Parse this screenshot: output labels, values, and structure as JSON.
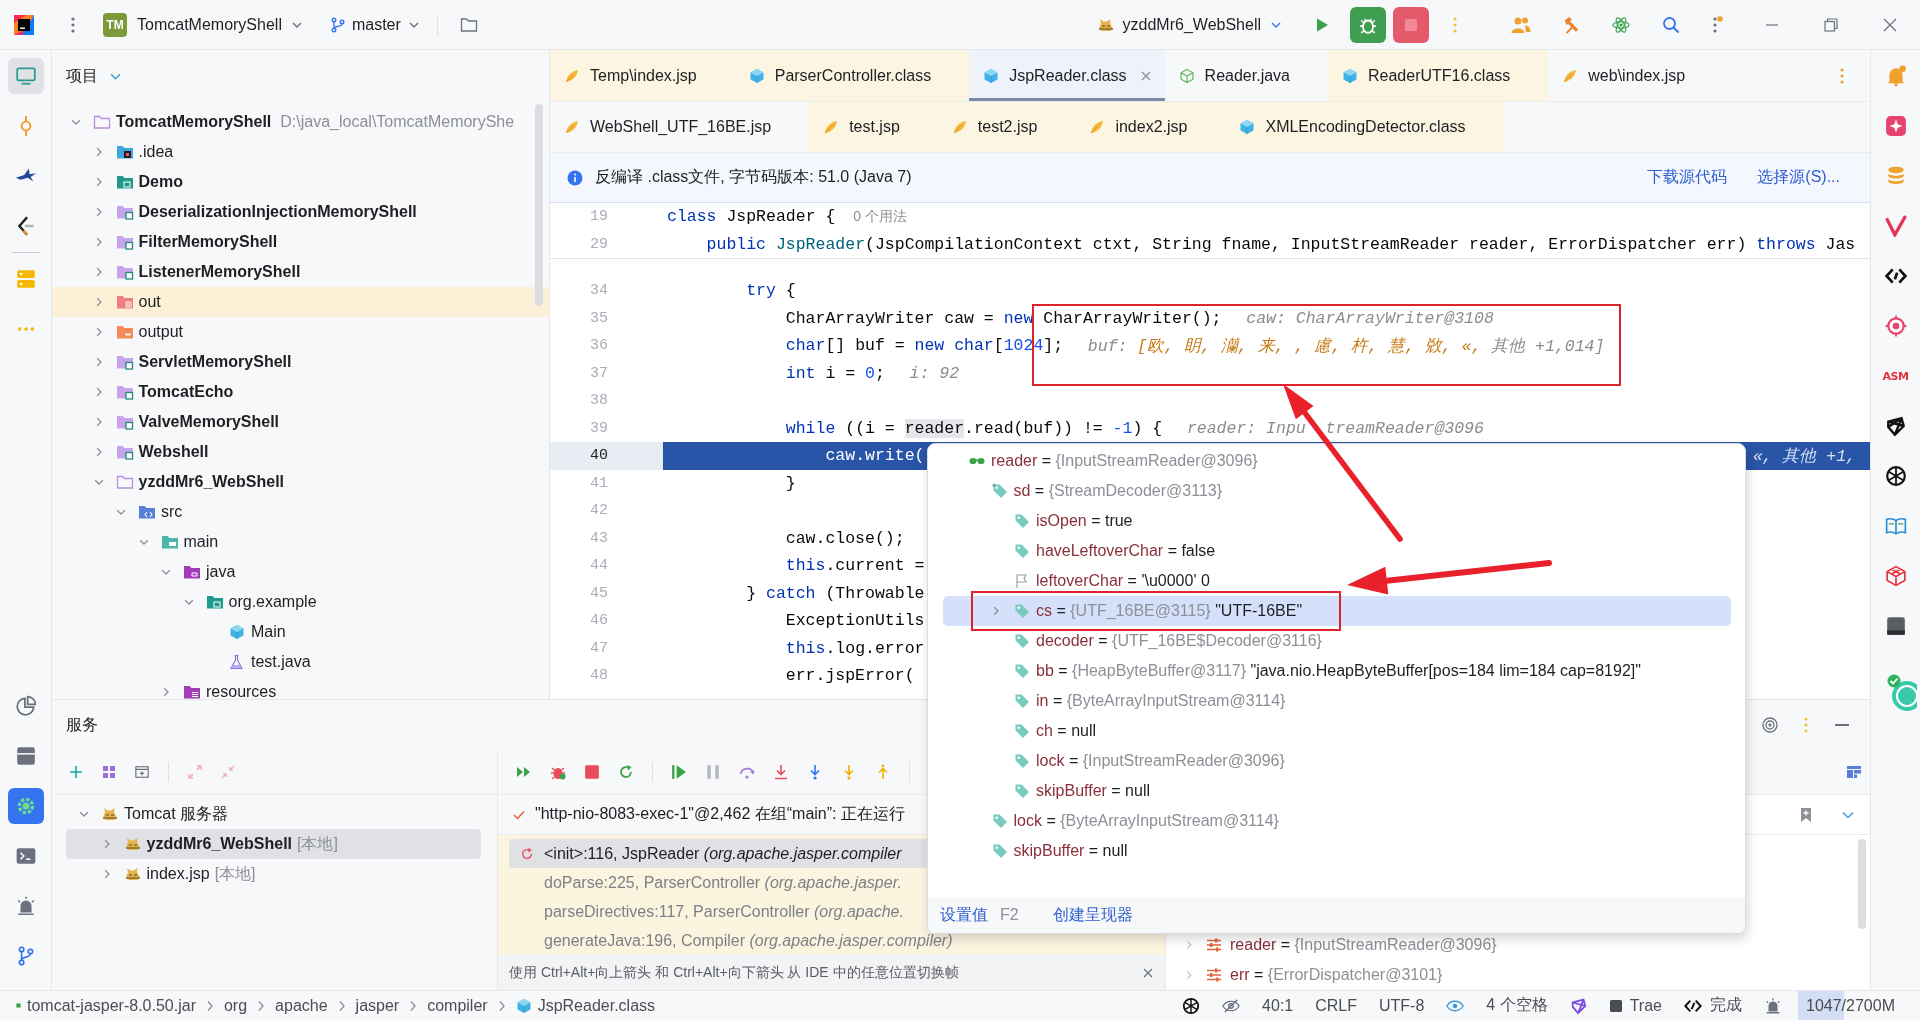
{
  "title_bar": {
    "project_badge": "TM",
    "project": "TomcatMemoryShell",
    "branch": "master",
    "run_config": "yzddMr6_WebShell"
  },
  "left_strip": {
    "top": [
      {
        "kind": "project",
        "selected": true
      },
      {
        "kind": "commit",
        "selected": false
      },
      {
        "kind": "plane",
        "selected": false
      },
      {
        "kind": "curly",
        "selected": false
      },
      {
        "kind": "server",
        "selected": false
      },
      {
        "kind": "more",
        "selected": false
      }
    ],
    "bottom": [
      {
        "kind": "profiler",
        "selected": false
      },
      {
        "kind": "archive",
        "selected": false
      },
      {
        "kind": "services",
        "selected": true
      },
      {
        "kind": "terminal",
        "selected": false
      },
      {
        "kind": "alarm",
        "selected": false
      },
      {
        "kind": "git",
        "selected": false
      }
    ]
  },
  "right_strip": [
    {
      "kind": "bell"
    },
    {
      "kind": "sparkle"
    },
    {
      "kind": "database"
    },
    {
      "kind": "vlogo"
    },
    {
      "kind": "code"
    },
    {
      "kind": "target"
    },
    {
      "kind": "asm",
      "label": "ASM"
    },
    {
      "kind": "gem"
    },
    {
      "kind": "wheel"
    },
    {
      "kind": "book"
    },
    {
      "kind": "cube"
    },
    {
      "kind": "square"
    },
    {
      "kind": "avatar"
    }
  ],
  "project_panel": {
    "title": "项目",
    "tree": [
      {
        "name": "TomcatMemoryShell",
        "path": "D:\\java_local\\TomcatMemoryShe",
        "kind": "project",
        "bold": true,
        "expanded": true,
        "highlighted": false,
        "children": [
          {
            "name": ".idea",
            "kind": "idea",
            "bold": false,
            "expanded": false,
            "highlighted": false
          },
          {
            "name": "Demo",
            "kind": "package",
            "bold": true,
            "expanded": false,
            "highlighted": false
          },
          {
            "name": "DeserializationInjectionMemoryShell",
            "kind": "module",
            "bold": true,
            "expanded": false,
            "highlighted": false
          },
          {
            "name": "FilterMemoryShell",
            "kind": "module",
            "bold": true,
            "expanded": false,
            "highlighted": false
          },
          {
            "name": "ListenerMemoryShell",
            "kind": "module",
            "bold": true,
            "expanded": false,
            "highlighted": false
          },
          {
            "name": "out",
            "kind": "excluded",
            "bold": false,
            "expanded": false,
            "highlighted": true
          },
          {
            "name": "output",
            "kind": "output",
            "bold": false,
            "expanded": false,
            "highlighted": false
          },
          {
            "name": "ServletMemoryShell",
            "kind": "module",
            "bold": true,
            "expanded": false,
            "highlighted": false
          },
          {
            "name": "TomcatEcho",
            "kind": "module",
            "bold": true,
            "expanded": false,
            "highlighted": false
          },
          {
            "name": "ValveMemoryShell",
            "kind": "module",
            "bold": true,
            "expanded": false,
            "highlighted": false
          },
          {
            "name": "Webshell",
            "kind": "module",
            "bold": true,
            "expanded": false,
            "highlighted": false
          },
          {
            "name": "yzddMr6_WebShell",
            "kind": "project",
            "bold": true,
            "expanded": true,
            "highlighted": false,
            "children": [
              {
                "name": "src",
                "kind": "sources",
                "bold": false,
                "expanded": true,
                "highlighted": false,
                "children": [
                  {
                    "name": "main",
                    "kind": "main",
                    "bold": false,
                    "expanded": true,
                    "highlighted": false,
                    "children": [
                      {
                        "name": "java",
                        "kind": "java",
                        "bold": false,
                        "expanded": true,
                        "highlighted": false,
                        "children": [
                          {
                            "name": "org.example",
                            "kind": "package",
                            "bold": false,
                            "expanded": true,
                            "highlighted": false,
                            "children": [
                              {
                                "name": "Main",
                                "kind": "class",
                                "bold": false,
                                "highlighted": false
                              },
                              {
                                "name": "test.java",
                                "kind": "test",
                                "bold": false,
                                "highlighted": false
                              }
                            ]
                          }
                        ]
                      },
                      {
                        "name": "resources",
                        "kind": "resources",
                        "bold": false,
                        "expanded": false,
                        "highlighted": false
                      }
                    ]
                  }
                ]
              }
            ]
          }
        ]
      }
    ]
  },
  "editor": {
    "tab_rows": [
      [
        {
          "label": "Temp\\index.jsp",
          "kind": "jsp",
          "selected": false,
          "tinted": true
        },
        {
          "label": "ParserController.class",
          "kind": "class",
          "selected": false,
          "tinted": true
        },
        {
          "label": "JspReader.class",
          "kind": "class",
          "selected": true,
          "tinted": false
        },
        {
          "label": "Reader.java",
          "kind": "source",
          "selected": false,
          "tinted": false
        },
        {
          "label": "ReaderUTF16.class",
          "kind": "class",
          "selected": false,
          "tinted": true
        },
        {
          "label": "web\\index.jsp",
          "kind": "jsp",
          "selected": false,
          "tinted": false
        }
      ],
      [
        {
          "label": "WebShell_UTF_16BE.jsp",
          "kind": "jsp",
          "selected": false,
          "tinted": false
        },
        {
          "label": "test.jsp",
          "kind": "jsp",
          "selected": false,
          "tinted": true
        },
        {
          "label": "test2.jsp",
          "kind": "jsp",
          "selected": false,
          "tinted": true
        },
        {
          "label": "index2.jsp",
          "kind": "jsp",
          "selected": false,
          "tinted": true
        },
        {
          "label": "XMLEncodingDetector.class",
          "kind": "class",
          "selected": false,
          "tinted": true
        }
      ]
    ],
    "banner": {
      "text": "反编译 .class文件, 字节码版本: 51.0 (Java 7)",
      "links": [
        "下载源代码",
        "选择源(S)..."
      ]
    },
    "sticky_lines": [
      {
        "number": "19",
        "tokens": [
          {
            "kind": "keyword",
            "text": "class"
          },
          {
            "kind": "plain",
            "text": " JspReader {"
          }
        ],
        "hint": {
          "kind": "usage",
          "text": "0 个用法"
        }
      },
      {
        "number": "29",
        "tokens": [
          {
            "kind": "keyword",
            "text": "    public"
          },
          {
            "kind": "declaration",
            "text": " JspReader"
          },
          {
            "kind": "plain",
            "text": "(JspCompilationContext ctxt, String fname, InputStreamReader reader, ErrorDispatcher err) "
          },
          {
            "kind": "keyword",
            "text": "throws"
          },
          {
            "kind": "plain",
            "text": " Jas"
          }
        ]
      }
    ],
    "lines": [
      {
        "number": "34",
        "current": false,
        "tokens": [
          {
            "kind": "keyword",
            "text": "        try"
          },
          {
            "kind": "plain",
            "text": " {"
          }
        ]
      },
      {
        "number": "35",
        "current": false,
        "tokens": [
          {
            "kind": "plain",
            "text": "            CharArrayWriter caw = "
          },
          {
            "kind": "keyword",
            "text": "new"
          },
          {
            "kind": "plain",
            "text": " CharArrayWriter();"
          }
        ],
        "hint": {
          "kind": "object",
          "text": "caw: CharArrayWriter@3108"
        }
      },
      {
        "number": "36",
        "current": false,
        "tokens": [
          {
            "kind": "keyword",
            "text": "            char"
          },
          {
            "kind": "plain",
            "text": "[] buf = "
          },
          {
            "kind": "keyword",
            "text": "new char"
          },
          {
            "kind": "plain",
            "text": "["
          },
          {
            "kind": "number",
            "text": "1024"
          },
          {
            "kind": "plain",
            "text": "];"
          }
        ],
        "hint": {
          "kind": "array",
          "text": "buf:",
          "value": "[欧, 眀, 灡, 来, , 慮, 杵, 慧, 敚, «,",
          "more": "其他 +1,014]"
        }
      },
      {
        "number": "37",
        "current": false,
        "tokens": [
          {
            "kind": "keyword",
            "text": "            int"
          },
          {
            "kind": "plain",
            "text": " i = "
          },
          {
            "kind": "number",
            "text": "0"
          },
          {
            "kind": "plain",
            "text": ";"
          }
        ],
        "hint": {
          "kind": "object",
          "text": "i: 92"
        }
      },
      {
        "number": "38",
        "current": false
      },
      {
        "number": "39",
        "current": false,
        "tokens": [
          {
            "kind": "keyword",
            "text": "            while"
          },
          {
            "kind": "plain",
            "text": " ((i = "
          },
          {
            "kind": "marked",
            "text": "reader"
          },
          {
            "kind": "plain",
            "text": ".read(buf)) != "
          },
          {
            "kind": "number",
            "text": "-1"
          },
          {
            "kind": "plain",
            "text": ") {"
          }
        ],
        "hint": {
          "kind": "split",
          "text": "reader: Inpu",
          "rest": "treamReader@3096"
        }
      },
      {
        "number": "40",
        "current": true,
        "tokens": [
          {
            "kind": "plain",
            "text": "                caw.write("
          }
        ],
        "hint": {
          "kind": "object",
          "text": "«, 其他 +1,"
        }
      },
      {
        "number": "41",
        "current": false,
        "tokens": [
          {
            "kind": "plain",
            "text": "            }"
          }
        ]
      },
      {
        "number": "42",
        "current": false
      },
      {
        "number": "43",
        "current": false,
        "tokens": [
          {
            "kind": "plain",
            "text": "            caw.close();"
          }
        ]
      },
      {
        "number": "44",
        "current": false,
        "tokens": [
          {
            "kind": "keyword",
            "text": "            this"
          },
          {
            "kind": "plain",
            "text": ".current ="
          }
        ]
      },
      {
        "number": "45",
        "current": false,
        "tokens": [
          {
            "kind": "plain",
            "text": "        } "
          },
          {
            "kind": "keyword",
            "text": "catch"
          },
          {
            "kind": "plain",
            "text": " (Throwable"
          }
        ]
      },
      {
        "number": "46",
        "current": false,
        "tokens": [
          {
            "kind": "plain",
            "text": "            ExceptionUtils"
          }
        ]
      },
      {
        "number": "47",
        "current": false,
        "tokens": [
          {
            "kind": "keyword",
            "text": "            this"
          },
          {
            "kind": "plain",
            "text": ".log.error"
          }
        ]
      },
      {
        "number": "48",
        "current": false,
        "tokens": [
          {
            "kind": "plain",
            "text": "            err.jspError("
          }
        ]
      }
    ]
  },
  "services": {
    "title": "服务",
    "tree": [
      {
        "name": "Tomcat 服务器",
        "bold": false,
        "expanded": true,
        "selected": false,
        "children": [
          {
            "name": "yzddMr6_WebShell",
            "tag": "[本地]",
            "bold": true,
            "expanded": false,
            "selected": true
          },
          {
            "name": "index.jsp",
            "tag": "[本地]",
            "bold": false,
            "expanded": false,
            "selected": false
          }
        ]
      }
    ]
  },
  "debugger": {
    "thread": "\"http-nio-8083-exec-1\"@2,462 在组“main”: 正在运行",
    "frames": [
      {
        "text": "<init>:116, JspReader *(org.apache.jasper.compiler*",
        "selected": true
      },
      {
        "text": "doParse:225, ParserController *(org.apache.jasper.*",
        "selected": false
      },
      {
        "text": "parseDirectives:117, ParserController *(org.apache.*",
        "selected": false
      },
      {
        "text": "generateJava:196, Compiler *(org.apache.jasper.compiler)*",
        "selected": false
      }
    ],
    "hint": "使用 Ctrl+Alt+向上箭头 和 Ctrl+Alt+向下箭头 从 IDE 中的任意位置切换帧",
    "variables": [
      {
        "name": "reader",
        "op": "=",
        "type": "{InputStreamReader@3096}"
      },
      {
        "name": "err",
        "op": "=",
        "type": "{ErrorDispatcher@3101}"
      }
    ]
  },
  "popup": {
    "nodes": [
      {
        "name": "reader",
        "op": "=",
        "type": "{InputStreamReader@3096}",
        "kind": "watch",
        "selected": false,
        "children": [
          {
            "name": "sd",
            "op": "=",
            "type": "{StreamDecoder@3113}",
            "kind": "marked",
            "selected": false,
            "children": [
              {
                "name": "isOpen",
                "op": "=",
                "value": "true",
                "kind": "field",
                "selected": false
              },
              {
                "name": "haveLeftoverChar",
                "op": "=",
                "value": "false",
                "kind": "field",
                "selected": false
              },
              {
                "name": "leftoverChar",
                "op": "=",
                "value": "'\\u0000' 0",
                "kind": "flag",
                "selected": false
              },
              {
                "name": "cs",
                "op": "=",
                "type": "{UTF_16BE@3115}",
                "value": "\"UTF-16BE\"",
                "kind": "field",
                "selected": true
              },
              {
                "name": "decoder",
                "op": "=",
                "type": "{UTF_16BE$Decoder@3116}",
                "kind": "field",
                "selected": false
              },
              {
                "name": "bb",
                "op": "=",
                "type": "{HeapByteBuffer@3117}",
                "value": "\"java.nio.HeapByteBuffer[pos=184 lim=184 cap=8192]\"",
                "kind": "field",
                "selected": false
              },
              {
                "name": "in",
                "op": "=",
                "type": "{ByteArrayInputStream@3114}",
                "kind": "field",
                "selected": false
              },
              {
                "name": "ch",
                "op": "=",
                "value": "null",
                "kind": "field",
                "selected": false
              },
              {
                "name": "lock",
                "op": "=",
                "type": "{InputStreamReader@3096}",
                "kind": "field",
                "selected": false
              },
              {
                "name": "skipBuffer",
                "op": "=",
                "value": "null",
                "kind": "field",
                "selected": false
              }
            ]
          },
          {
            "name": "lock",
            "op": "=",
            "type": "{ByteArrayInputStream@3114}",
            "kind": "field",
            "selected": false
          },
          {
            "name": "skipBuffer",
            "op": "=",
            "value": "null",
            "kind": "field",
            "selected": false
          }
        ]
      }
    ],
    "footer": {
      "action": "设置值",
      "shortcut": "F2",
      "link": "创建呈现器"
    }
  },
  "status_bar": {
    "breadcrumbs": [
      {
        "label": "tomcat-jasper-8.0.50.jar",
        "kind": "jar"
      },
      {
        "label": "org",
        "kind": "package"
      },
      {
        "label": "apache",
        "kind": "package"
      },
      {
        "label": "jasper",
        "kind": "package"
      },
      {
        "label": "compiler",
        "kind": "package"
      },
      {
        "label": "JspReader.class",
        "kind": "class"
      }
    ],
    "position": "40:1",
    "line_ending": "CRLF",
    "encoding": "UTF-8",
    "indent": "4 个空格",
    "plugin": "Trae",
    "ai_status": "完成",
    "memory": {
      "text": "1047/2700M",
      "level": 0.38
    }
  }
}
